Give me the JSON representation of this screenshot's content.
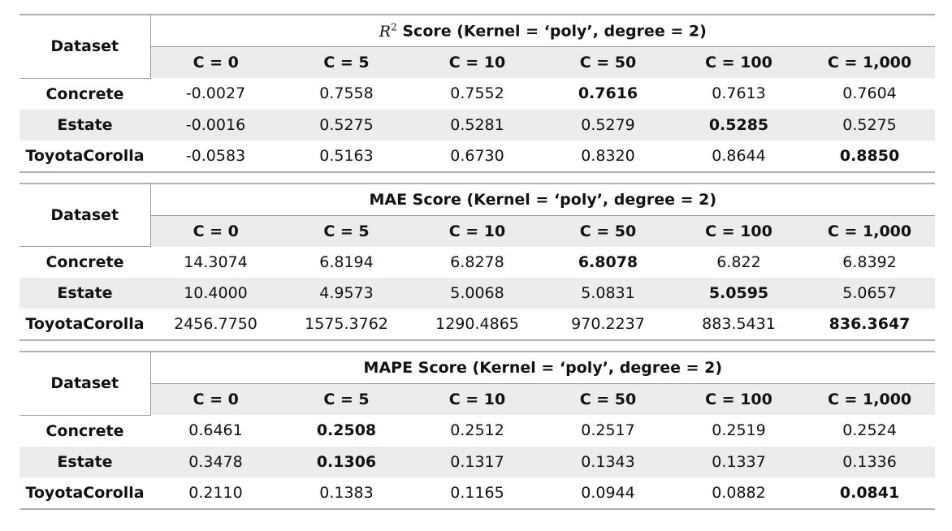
{
  "dataset_label": "Dataset",
  "c_labels": [
    "C = 0",
    "C = 5",
    "C = 10",
    "C = 50",
    "C = 100",
    "C = 1,000"
  ],
  "tables": [
    {
      "title_prefix": "R",
      "title_sup": "2",
      "title": "Score (Kernel = ‘poly’, degree = 2)",
      "rows": [
        {
          "dataset": "Concrete",
          "values": [
            "-0.0027",
            "0.7558",
            "0.7552",
            "0.7616",
            "0.7613",
            "0.7604"
          ],
          "best": 3
        },
        {
          "dataset": "Estate",
          "values": [
            "-0.0016",
            "0.5275",
            "0.5281",
            "0.5279",
            "0.5285",
            "0.5275"
          ],
          "best": 4
        },
        {
          "dataset": "ToyotaCorolla",
          "values": [
            "-0.0583",
            "0.5163",
            "0.6730",
            "0.8320",
            "0.8644",
            "0.8850"
          ],
          "best": 5
        }
      ]
    },
    {
      "title_prefix": "",
      "title_sup": "",
      "title": "MAE Score (Kernel = ‘poly’, degree = 2)",
      "rows": [
        {
          "dataset": "Concrete",
          "values": [
            "14.3074",
            "6.8194",
            "6.8278",
            "6.8078",
            "6.822",
            "6.8392"
          ],
          "best": 3
        },
        {
          "dataset": "Estate",
          "values": [
            "10.4000",
            "4.9573",
            "5.0068",
            "5.0831",
            "5.0595",
            "5.0657"
          ],
          "best": 4
        },
        {
          "dataset": "ToyotaCorolla",
          "values": [
            "2456.7750",
            "1575.3762",
            "1290.4865",
            "970.2237",
            "883.5431",
            "836.3647"
          ],
          "best": 5
        }
      ]
    },
    {
      "title_prefix": "",
      "title_sup": "",
      "title": "MAPE Score (Kernel = ‘poly’, degree = 2)",
      "rows": [
        {
          "dataset": "Concrete",
          "values": [
            "0.6461",
            "0.2508",
            "0.2512",
            "0.2517",
            "0.2519",
            "0.2524"
          ],
          "best": 1
        },
        {
          "dataset": "Estate",
          "values": [
            "0.3478",
            "0.1306",
            "0.1317",
            "0.1343",
            "0.1337",
            "0.1336"
          ],
          "best": 1
        },
        {
          "dataset": "ToyotaCorolla",
          "values": [
            "0.2110",
            "0.1383",
            "0.1165",
            "0.0944",
            "0.0882",
            "0.0841"
          ],
          "best": 5
        }
      ]
    }
  ]
}
